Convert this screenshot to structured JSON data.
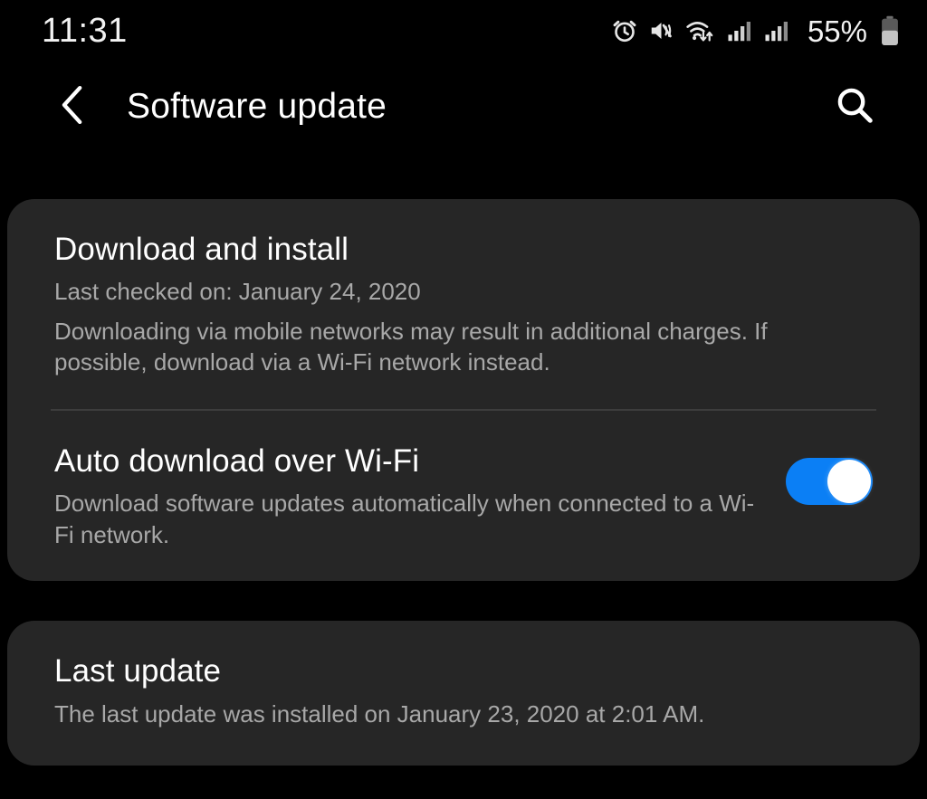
{
  "status_bar": {
    "clock": "11:31",
    "battery_percent": "55%",
    "battery_level": 55,
    "icons": [
      "alarm-icon",
      "mute-vibrate-icon",
      "wifi-data-transfer-icon",
      "signal-bars-sim1-icon",
      "signal-bars-sim2-icon",
      "battery-icon"
    ]
  },
  "app_bar": {
    "back_icon": "chevron-left-icon",
    "title": "Software update",
    "search_icon": "search-icon"
  },
  "cards": {
    "download_install": {
      "title": "Download and install",
      "last_checked": "Last checked on: January 24, 2020",
      "description": "Downloading via mobile networks may result in additional charges. If possible, download via a Wi-Fi network instead."
    },
    "auto_download": {
      "title": "Auto download over Wi-Fi",
      "description": "Download software updates automatically when connected to a Wi-Fi network.",
      "toggle_state": "on"
    },
    "last_update": {
      "title": "Last update",
      "description": "The last update was installed on January 23, 2020 at 2:01 AM."
    }
  },
  "colors": {
    "page_background": "#000000",
    "card_background": "#262626",
    "primary_text": "#ffffff",
    "secondary_text": "#a8a8a8",
    "accent_toggle_on": "#0b7ff5",
    "divider": "#3d3d3d"
  }
}
